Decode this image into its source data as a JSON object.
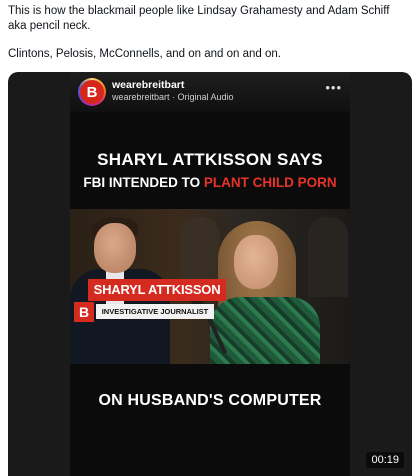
{
  "post": {
    "line1": "This is how the blackmail people like Lindsay Grahamesty and Adam Schiff aka pencil neck.",
    "line2": "Clintons, Pelosis, McConnells, and on and on and on."
  },
  "video": {
    "account": {
      "logo_letter": "B",
      "handle": "wearebreitbart",
      "subline": "wearebreitbart · Original Audio"
    },
    "more_icon": "more-horizontal-icon",
    "headline": {
      "line1": "SHARYL ATTKISSON SAYS",
      "line2_prefix": "FBI INTENDED TO ",
      "line2_highlight": "PLANT CHILD PORN"
    },
    "lower_third": {
      "logo_letter": "B",
      "name": "SHARYL ATTKISSON",
      "title": "INVESTIGATIVE JOURNALIST"
    },
    "caption": "ON HUSBAND'S COMPUTER",
    "timestamp": "00:19"
  },
  "colors": {
    "brand_red": "#d52a20",
    "highlight_red": "#e8332a",
    "player_bg": "#1a1a1a"
  }
}
